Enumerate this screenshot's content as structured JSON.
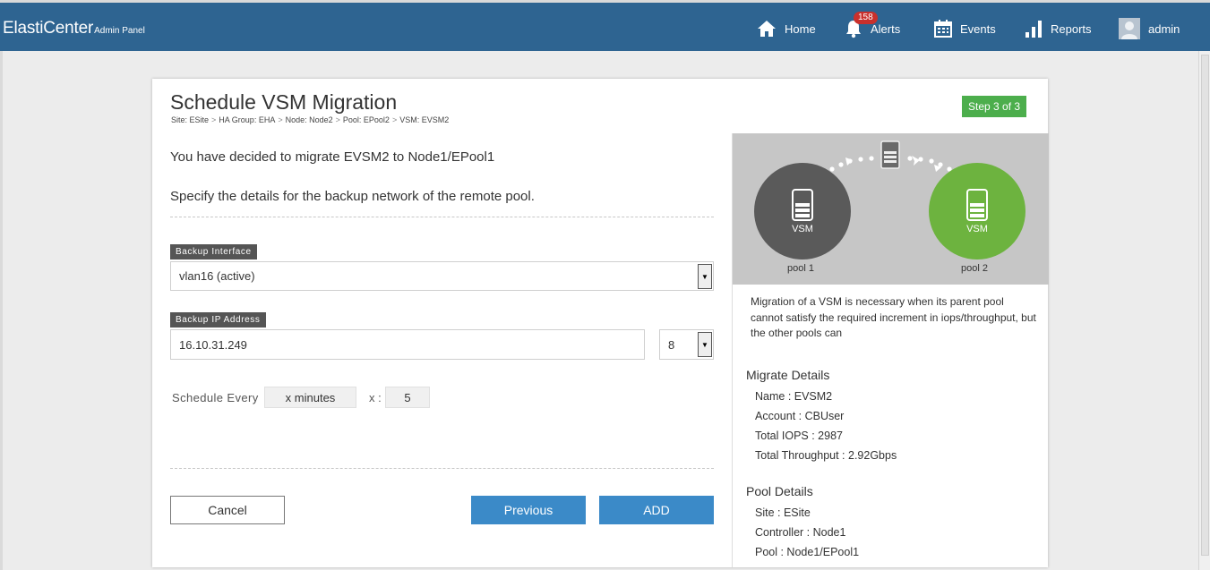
{
  "app": {
    "brand": "ElastiCenter",
    "brand_sub": "Admin Panel"
  },
  "nav": {
    "home": "Home",
    "alerts": "Alerts",
    "alerts_count": "158",
    "events": "Events",
    "reports": "Reports",
    "user": "admin"
  },
  "page": {
    "title": "Schedule VSM Migration",
    "breadcrumb": [
      "Site: ESite",
      "HA Group: EHA",
      "Node: Node2",
      "Pool: EPool2",
      "VSM: EVSM2"
    ],
    "step": "Step 3 of 3",
    "intro_line1": "You have decided to migrate EVSM2 to Node1/EPool1",
    "intro_line2": "Specify the details for the backup network of the remote pool."
  },
  "form": {
    "backup_interface_label": "Backup Interface",
    "backup_interface_value": "vlan16 (active)",
    "backup_ip_label": "Backup IP Address",
    "backup_ip_value": "16.10.31.249",
    "netmask_value": "8",
    "schedule_label": "Schedule Every",
    "schedule_unit": "x minutes",
    "schedule_x_label": "x :",
    "schedule_value": "5"
  },
  "buttons": {
    "cancel": "Cancel",
    "previous": "Previous",
    "add": "ADD"
  },
  "side": {
    "source_node_label": "VSM",
    "target_node_label": "VSM",
    "source_pool": "pool 1",
    "target_pool": "pool 2",
    "description": "Migration of a VSM is necessary when its parent pool cannot satisfy the required increment in iops/throughput, but the other pools can",
    "migrate_title": "Migrate Details",
    "migrate": {
      "name": "Name : EVSM2",
      "account": "Account : CBUser",
      "iops": "Total IOPS : 2987",
      "throughput": "Total Throughput : 2.92Gbps"
    },
    "pool_title": "Pool Details",
    "pool": {
      "site": "Site : ESite",
      "controller": "Controller : Node1",
      "pool": "Pool : Node1/EPool1"
    }
  },
  "colors": {
    "topbar": "#2e6491",
    "primary_button": "#3b8ac8",
    "step_badge": "#4cae4c",
    "source_pool": "#5a5a5a",
    "target_pool": "#6db33f",
    "alert_badge": "#c9302c"
  }
}
